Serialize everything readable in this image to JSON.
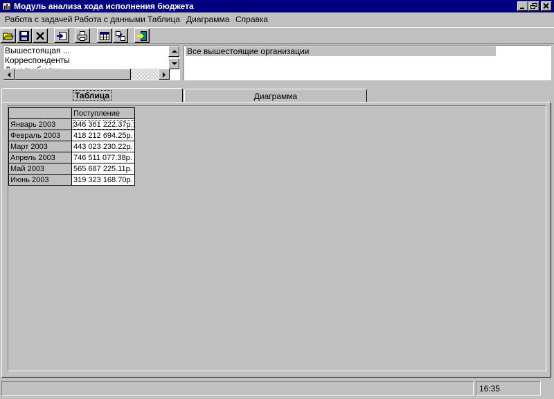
{
  "window": {
    "title": "Модуль анализа хода исполнения бюджета",
    "icon": "app-icon",
    "controls": [
      "minimize-icon",
      "restore-icon",
      "close-icon"
    ]
  },
  "menu": {
    "items": [
      {
        "label": "Работа с задачей"
      },
      {
        "label": "Работа с данными"
      },
      {
        "label": "Таблица"
      },
      {
        "label": "Диаграмма"
      },
      {
        "label": "Справка"
      }
    ]
  },
  "toolbar": {
    "buttons": [
      "open-folder-icon",
      "save-icon",
      "delete-icon",
      "import-icon",
      "print-icon",
      "table-icon",
      "calculate-icon",
      "exit-icon"
    ]
  },
  "filters": {
    "list_items": [
      "Вышестоящая ...",
      "Корреспонденты",
      "Доходы бюдже"
    ],
    "organization_selection": "Все вышестоящие организации"
  },
  "tabs": [
    {
      "label": "Таблица",
      "active": true
    },
    {
      "label": "Диаграмма",
      "active": false
    }
  ],
  "table": {
    "column_header": "Поступление",
    "rows": [
      {
        "label": "Январь 2003",
        "value": "346 361 222.37р."
      },
      {
        "label": "Февраль 2003",
        "value": "418 212 694.25р."
      },
      {
        "label": "Март 2003",
        "value": "443 023 230.22р."
      },
      {
        "label": "Апрель 2003",
        "value": "746 511 077.38р."
      },
      {
        "label": "Май 2003",
        "value": "565 687 225.11р."
      },
      {
        "label": "Июнь 2003",
        "value": "319 323 168.70р."
      }
    ]
  },
  "status": {
    "message": "",
    "time": "16:35"
  }
}
